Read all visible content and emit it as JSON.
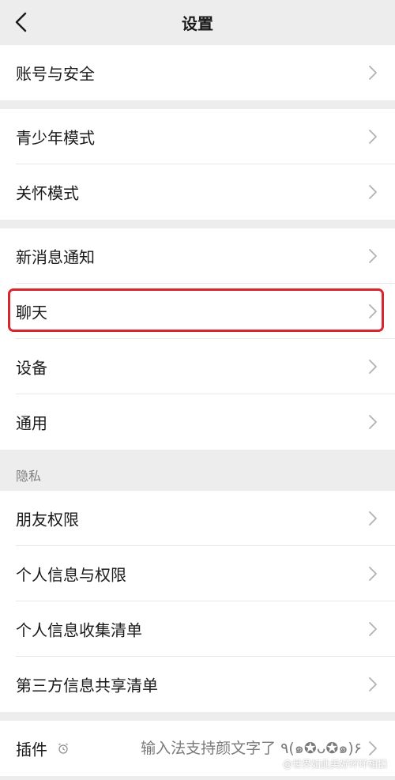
{
  "header": {
    "title": "设置"
  },
  "groups": {
    "account": {
      "account_security": "账号与安全"
    },
    "modes": {
      "teen_mode": "青少年模式",
      "care_mode": "关怀模式"
    },
    "general": {
      "notifications": "新消息通知",
      "chat": "聊天",
      "devices": "设备",
      "general": "通用"
    },
    "privacy": {
      "header": "隐私",
      "friend_permissions": "朋友权限",
      "personal_info_permissions": "个人信息与权限",
      "personal_info_collection": "个人信息收集清单",
      "third_party_sharing": "第三方信息共享清单"
    },
    "plugins": {
      "label": "插件",
      "value": "输入法支持颜文字了 ٩(๑✪ᴗ✪๑)۶"
    }
  },
  "watermark": "@世界如此美好环环相扣",
  "colors": {
    "highlight": "#d9262c",
    "background": "#ededed"
  },
  "icons": {
    "back": "chevron-left-icon",
    "chevron": "chevron-right-icon",
    "plugin": "alarm-clock-icon"
  }
}
